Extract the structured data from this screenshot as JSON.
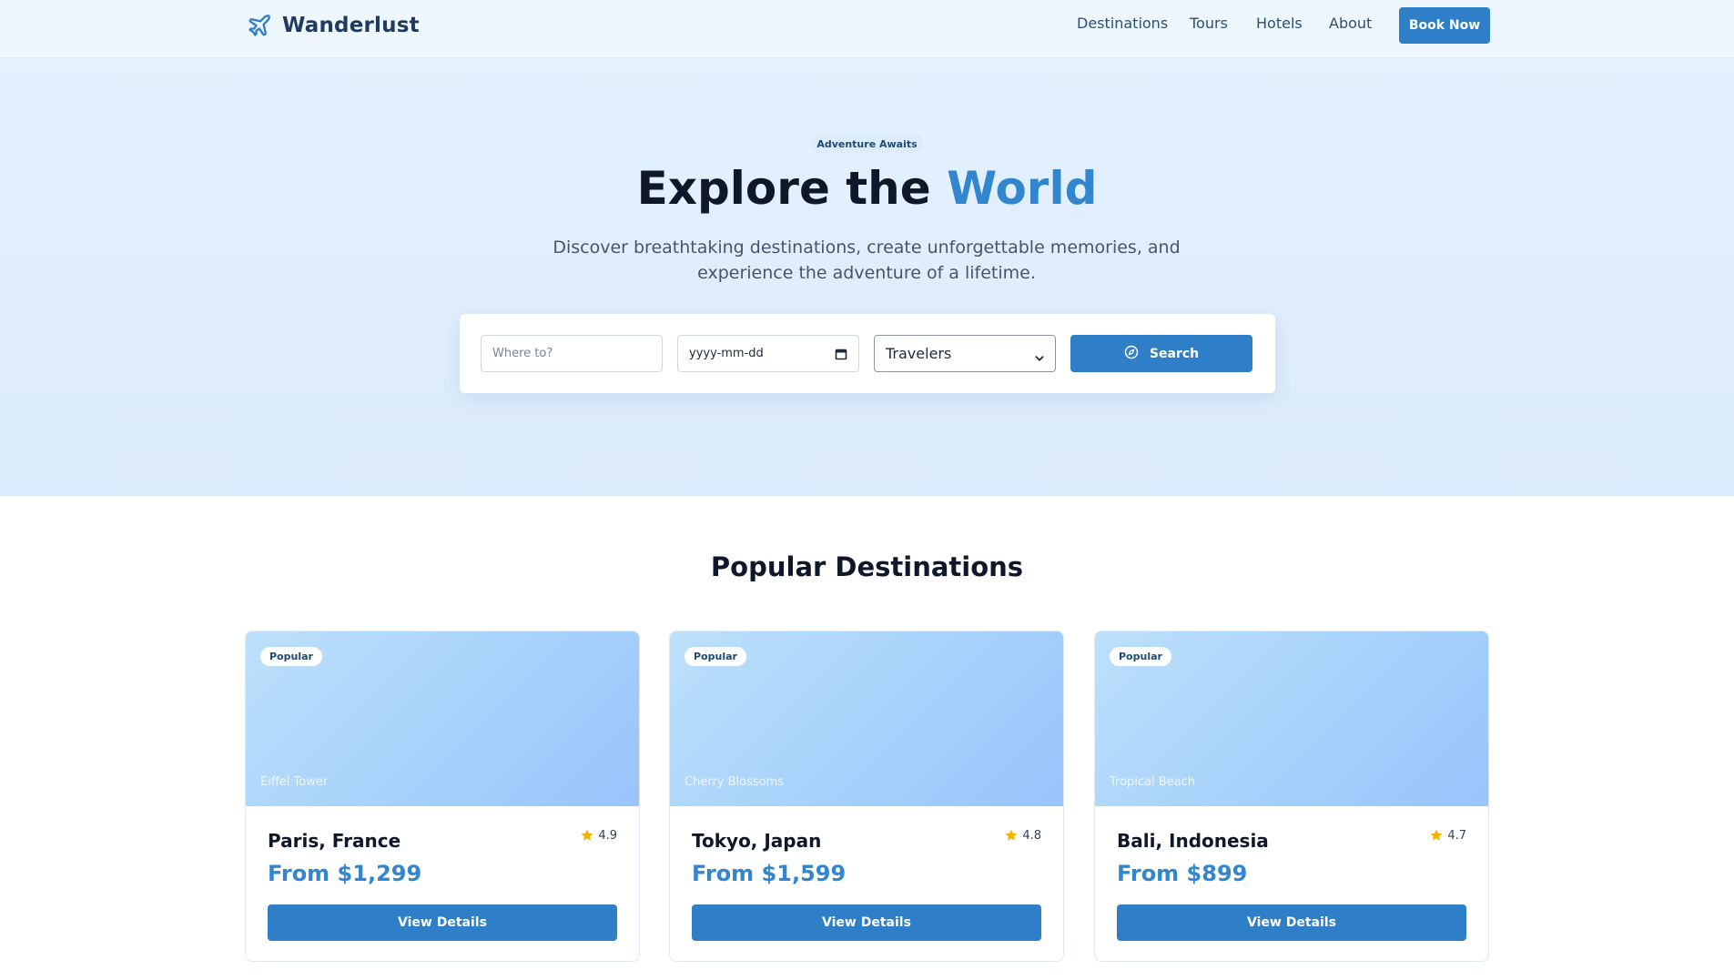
{
  "brand": {
    "name": "Wanderlust",
    "icon": "plane-icon",
    "color": "#1e3a5f"
  },
  "nav": {
    "links": [
      "Destinations",
      "Tours",
      "Hotels",
      "About"
    ],
    "cta": "Book Now"
  },
  "hero": {
    "eyebrow": "Adventure Awaits",
    "title_prefix": "Explore the ",
    "title_accent": "World",
    "subtitle": "Discover breathtaking destinations, create unforgettable memories, and experience the adventure of a lifetime."
  },
  "search": {
    "where_placeholder": "Where to?",
    "date_value": "yyyy-mm-dd",
    "travelers_value": "Travelers",
    "button_label": "Search",
    "button_icon": "compass-icon"
  },
  "destinations": {
    "title": "Popular Destinations",
    "cards": [
      {
        "badge": "Popular",
        "caption": "Eiffel Tower",
        "name": "Paris, France",
        "rating": "4.9",
        "price": "From $1,299",
        "button": "View Details"
      },
      {
        "badge": "Popular",
        "caption": "Cherry Blossoms",
        "name": "Tokyo, Japan",
        "rating": "4.8",
        "price": "From $1,599",
        "button": "View Details"
      },
      {
        "badge": "Popular",
        "caption": "Tropical Beach",
        "name": "Bali, Indonesia",
        "rating": "4.7",
        "price": "From $899",
        "button": "View Details"
      }
    ]
  },
  "colors": {
    "primary": "#2e7fc8",
    "accent_text": "#3186cf",
    "hero_bg": "#e5f1fd",
    "star": "#f5b400"
  }
}
